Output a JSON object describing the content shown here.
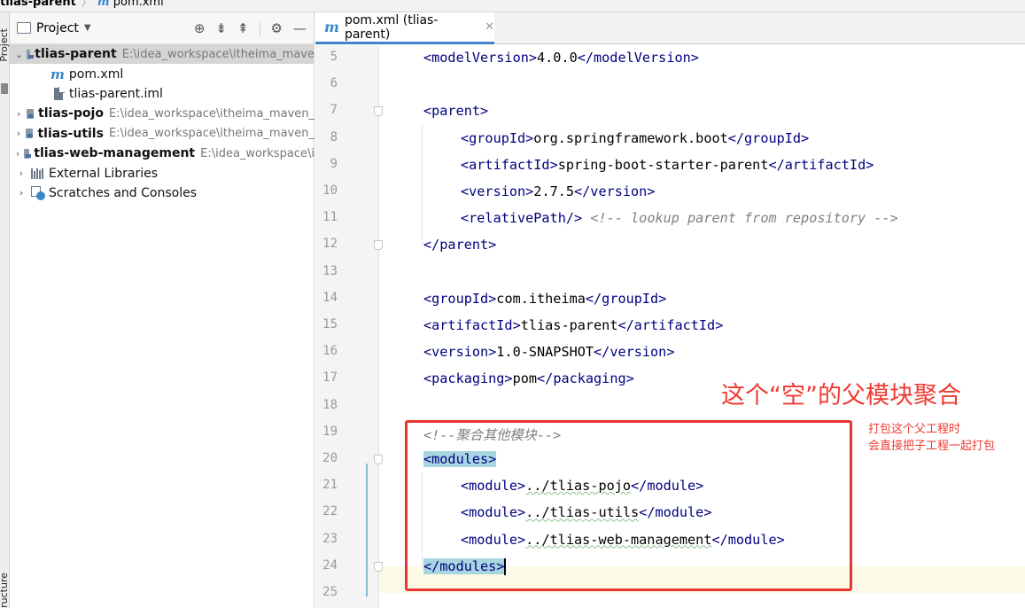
{
  "breadcrumb": {
    "project": "tlias-parent",
    "file": "pom.xml"
  },
  "left_stripe": {
    "top_label": "Project",
    "bottom_label": "Structure"
  },
  "project_panel": {
    "title": "Project",
    "tree": [
      {
        "name": "tlias-parent",
        "path": "E:\\idea_workspace\\itheima_mave"
      },
      {
        "name": "pom.xml"
      },
      {
        "name": "tlias-parent.iml"
      },
      {
        "name": "tlias-pojo",
        "path": "E:\\idea_workspace\\itheima_maven_"
      },
      {
        "name": "tlias-utils",
        "path": "E:\\idea_workspace\\itheima_maven_"
      },
      {
        "name": "tlias-web-management",
        "path": "E:\\idea_workspace\\i"
      },
      {
        "name": "External Libraries"
      },
      {
        "name": "Scratches and Consoles"
      }
    ]
  },
  "editor": {
    "tab_label": "pom.xml (tlias-parent)",
    "lines": {
      "l5": {
        "num": "5",
        "open": "<modelVersion>",
        "val": "4.0.0",
        "close": "</modelVersion>"
      },
      "l6": {
        "num": "6"
      },
      "l7": {
        "num": "7",
        "open": "<parent>"
      },
      "l8": {
        "num": "8",
        "open": "<groupId>",
        "val": "org.springframework.boot",
        "close": "</groupId>"
      },
      "l9": {
        "num": "9",
        "open": "<artifactId>",
        "val": "spring-boot-starter-parent",
        "close": "</artifactId>"
      },
      "l10": {
        "num": "10",
        "open": "<version>",
        "val": "2.7.5",
        "close": "</version>"
      },
      "l11": {
        "num": "11",
        "open": "<relativePath/>",
        "comment": "<!-- lookup parent from repository -->"
      },
      "l12": {
        "num": "12",
        "close": "</parent>"
      },
      "l13": {
        "num": "13"
      },
      "l14": {
        "num": "14",
        "open": "<groupId>",
        "val": "com.itheima",
        "close": "</groupId>"
      },
      "l15": {
        "num": "15",
        "open": "<artifactId>",
        "val": "tlias-parent",
        "close": "</artifactId>"
      },
      "l16": {
        "num": "16",
        "open": "<version>",
        "val": "1.0-SNAPSHOT",
        "close": "</version>"
      },
      "l17": {
        "num": "17",
        "open": "<packaging>",
        "val": "pom",
        "close": "</packaging>"
      },
      "l18": {
        "num": "18"
      },
      "l19": {
        "num": "19",
        "comment": "<!--聚合其他模块-->"
      },
      "l20": {
        "num": "20",
        "open": "<modules>"
      },
      "l21": {
        "num": "21",
        "open": "<module>",
        "val": "../tlias-pojo",
        "close": "</module>"
      },
      "l22": {
        "num": "22",
        "open": "<module>",
        "val": "../tlias-utils",
        "close": "</module>"
      },
      "l23": {
        "num": "23",
        "open": "<module>",
        "val": "../tlias-web-management",
        "close": "</module>"
      },
      "l24": {
        "num": "24",
        "close": "</modules>"
      },
      "l25": {
        "num": "25"
      }
    }
  },
  "annotation": {
    "title": "这个“空”的父模块聚合",
    "note_line1": "打包这个父工程时",
    "note_line2": "会直接把子工程一起打包",
    "color": "#ef3b33"
  }
}
